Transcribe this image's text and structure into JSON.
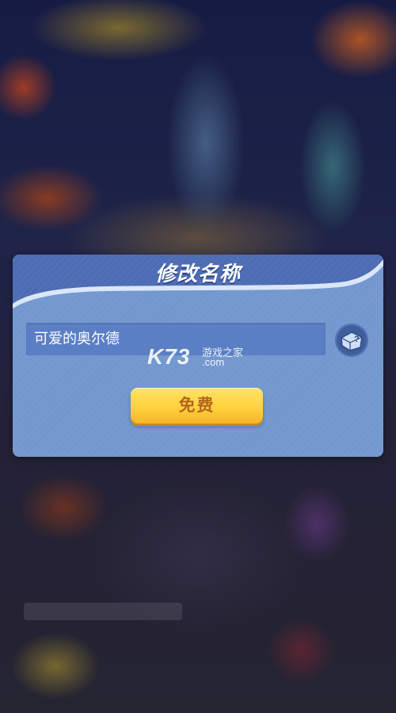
{
  "dialog": {
    "title": "修改名称",
    "name_value": "可爱的奥尔德",
    "random_icon": "dice-question-icon",
    "free_button_label": "免费"
  },
  "watermark": {
    "logo": "K73",
    "text_cn": "游戏之家",
    "text_domain": ".com"
  },
  "colors": {
    "dialog_body": "#7398cf",
    "dialog_header": "#4d6cb4",
    "input_bg": "#5b7fc4",
    "button_yellow": "#ffd23c",
    "button_text": "#b5661d"
  }
}
